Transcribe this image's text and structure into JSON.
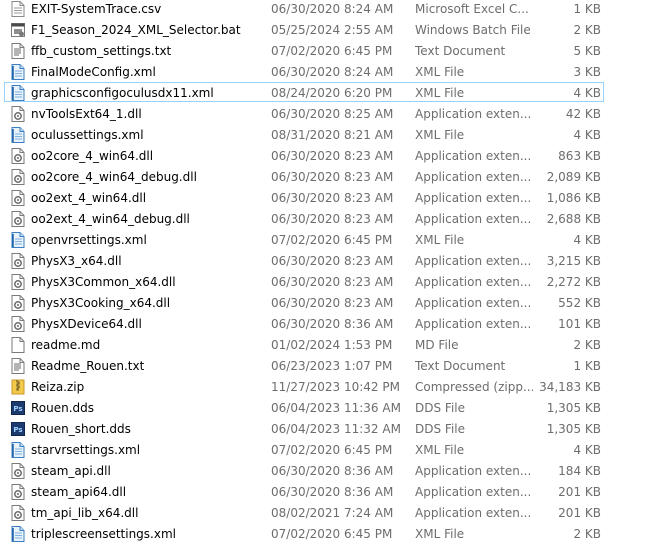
{
  "files": [
    {
      "name": "EXIT-SystemTrace.csv",
      "date": "06/30/2020 8:24 AM",
      "type": "Microsoft Excel C...",
      "size": "1 KB",
      "icon": "csv-file-icon"
    },
    {
      "name": "F1_Season_2024_XML_Selector.bat",
      "date": "05/25/2024 2:55 AM",
      "type": "Windows Batch File",
      "size": "2 KB",
      "icon": "batch-file-icon"
    },
    {
      "name": "ffb_custom_settings.txt",
      "date": "07/02/2020 6:45 PM",
      "type": "Text Document",
      "size": "5 KB",
      "icon": "text-file-icon"
    },
    {
      "name": "FinalModeConfig.xml",
      "date": "06/30/2020 8:24 AM",
      "type": "XML File",
      "size": "3 KB",
      "icon": "xml-file-icon"
    },
    {
      "name": "graphicsconfigoculusdx11.xml",
      "date": "08/24/2020 6:20 PM",
      "type": "XML File",
      "size": "4 KB",
      "icon": "xml-file-icon",
      "selected": true
    },
    {
      "name": "nvToolsExt64_1.dll",
      "date": "06/30/2020 8:25 AM",
      "type": "Application exten...",
      "size": "42 KB",
      "icon": "dll-file-icon"
    },
    {
      "name": "oculussettings.xml",
      "date": "08/31/2020 8:21 AM",
      "type": "XML File",
      "size": "4 KB",
      "icon": "xml-file-icon"
    },
    {
      "name": "oo2core_4_win64.dll",
      "date": "06/30/2020 8:23 AM",
      "type": "Application exten...",
      "size": "863 KB",
      "icon": "dll-file-icon"
    },
    {
      "name": "oo2core_4_win64_debug.dll",
      "date": "06/30/2020 8:23 AM",
      "type": "Application exten...",
      "size": "2,089 KB",
      "icon": "dll-file-icon"
    },
    {
      "name": "oo2ext_4_win64.dll",
      "date": "06/30/2020 8:23 AM",
      "type": "Application exten...",
      "size": "1,086 KB",
      "icon": "dll-file-icon"
    },
    {
      "name": "oo2ext_4_win64_debug.dll",
      "date": "06/30/2020 8:23 AM",
      "type": "Application exten...",
      "size": "2,688 KB",
      "icon": "dll-file-icon"
    },
    {
      "name": "openvrsettings.xml",
      "date": "07/02/2020 6:45 PM",
      "type": "XML File",
      "size": "4 KB",
      "icon": "xml-file-icon"
    },
    {
      "name": "PhysX3_x64.dll",
      "date": "06/30/2020 8:23 AM",
      "type": "Application exten...",
      "size": "3,215 KB",
      "icon": "dll-file-icon"
    },
    {
      "name": "PhysX3Common_x64.dll",
      "date": "06/30/2020 8:23 AM",
      "type": "Application exten...",
      "size": "2,272 KB",
      "icon": "dll-file-icon"
    },
    {
      "name": "PhysX3Cooking_x64.dll",
      "date": "06/30/2020 8:23 AM",
      "type": "Application exten...",
      "size": "552 KB",
      "icon": "dll-file-icon"
    },
    {
      "name": "PhysXDevice64.dll",
      "date": "06/30/2020 8:36 AM",
      "type": "Application exten...",
      "size": "101 KB",
      "icon": "dll-file-icon"
    },
    {
      "name": "readme.md",
      "date": "01/02/2024 1:53 PM",
      "type": "MD File",
      "size": "2 KB",
      "icon": "generic-file-icon"
    },
    {
      "name": "Readme_Rouen.txt",
      "date": "06/23/2023 1:07 PM",
      "type": "Text Document",
      "size": "1 KB",
      "icon": "text-file-icon"
    },
    {
      "name": "Reiza.zip",
      "date": "11/27/2023 10:42 PM",
      "type": "Compressed (zipp...",
      "size": "34,183 KB",
      "icon": "zip-folder-icon"
    },
    {
      "name": "Rouen.dds",
      "date": "06/04/2023 11:36 AM",
      "type": "DDS File",
      "size": "1,305 KB",
      "icon": "photoshop-file-icon"
    },
    {
      "name": "Rouen_short.dds",
      "date": "06/04/2023 11:32 AM",
      "type": "DDS File",
      "size": "1,305 KB",
      "icon": "photoshop-file-icon"
    },
    {
      "name": "starvrsettings.xml",
      "date": "07/02/2020 6:45 PM",
      "type": "XML File",
      "size": "4 KB",
      "icon": "xml-file-icon"
    },
    {
      "name": "steam_api.dll",
      "date": "06/30/2020 8:36 AM",
      "type": "Application exten...",
      "size": "184 KB",
      "icon": "dll-file-icon"
    },
    {
      "name": "steam_api64.dll",
      "date": "06/30/2020 8:36 AM",
      "type": "Application exten...",
      "size": "201 KB",
      "icon": "dll-file-icon"
    },
    {
      "name": "tm_api_lib_x64.dll",
      "date": "08/02/2021 7:24 AM",
      "type": "Application exten...",
      "size": "201 KB",
      "icon": "dll-file-icon"
    },
    {
      "name": "triplescreensettings.xml",
      "date": "07/02/2020 6:45 PM",
      "type": "XML File",
      "size": "2 KB",
      "icon": "xml-file-icon"
    }
  ]
}
